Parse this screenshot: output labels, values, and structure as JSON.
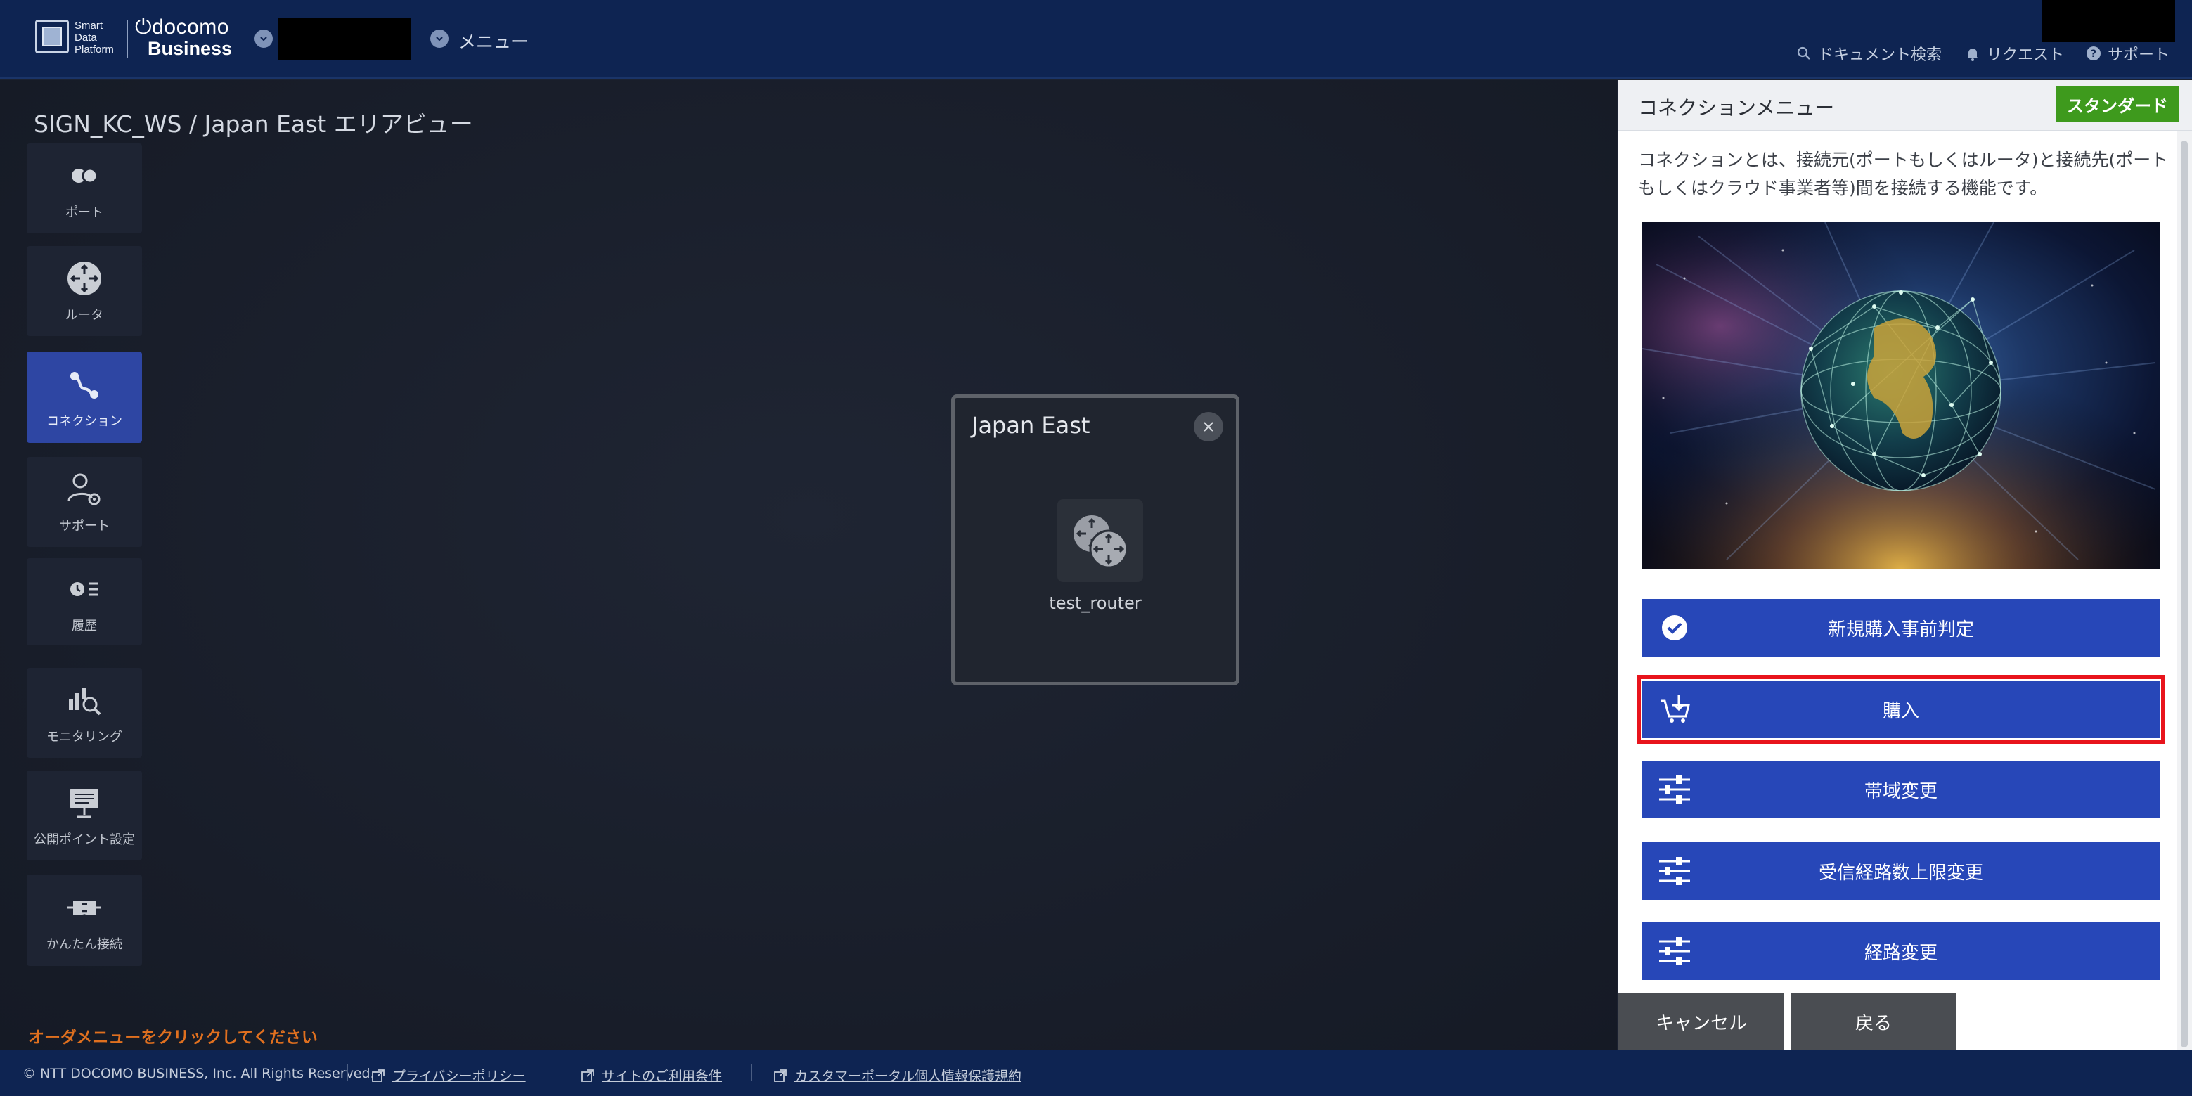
{
  "header": {
    "brand_lines": [
      "Smart",
      "Data",
      "Platform"
    ],
    "brand_docomo": "docomo",
    "brand_business": "Business",
    "menu_label": "メニュー",
    "links": {
      "doc_search": "ドキュメント検索",
      "request": "リクエスト",
      "support": "サポート"
    }
  },
  "main": {
    "page_title": "SIGN_KC_WS / Japan East エリアビュー",
    "order_hint": "オーダメニューをクリックしてください"
  },
  "sidebar": {
    "items": [
      {
        "label": "ポート",
        "icon": "port-icon",
        "active": false
      },
      {
        "label": "ルータ",
        "icon": "router-icon",
        "active": false
      },
      {
        "label": "コネクション",
        "icon": "connection-icon",
        "active": true
      },
      {
        "label": "サポート",
        "icon": "support-user-gear-icon",
        "active": false
      },
      {
        "label": "履歴",
        "icon": "history-icon",
        "active": false
      },
      {
        "label": "モニタリング",
        "icon": "monitoring-icon",
        "active": false
      },
      {
        "label": "公開ポイント設定",
        "icon": "public-point-icon",
        "active": false
      },
      {
        "label": "かんたん接続",
        "icon": "easy-connect-icon",
        "active": false
      }
    ]
  },
  "area_popup": {
    "title": "Japan East",
    "router_name": "test_router"
  },
  "panel": {
    "title": "コネクションメニュー",
    "badge": "スタンダード",
    "description": "コネクションとは、接続元(ポートもしくはルータ)と接続先(ポートもしくはクラウド事業者等)間を接続する機能です。",
    "actions": [
      {
        "label": "新規購入事前判定",
        "icon": "check-circle-icon",
        "highlighted": false
      },
      {
        "label": "購入",
        "icon": "cart-icon",
        "highlighted": true
      },
      {
        "label": "帯域変更",
        "icon": "sliders-icon",
        "highlighted": false
      },
      {
        "label": "受信経路数上限変更",
        "icon": "sliders-icon",
        "highlighted": false
      },
      {
        "label": "経路変更",
        "icon": "sliders-icon",
        "highlighted": false
      }
    ],
    "cancel_label": "キャンセル",
    "back_label": "戻る"
  },
  "footer": {
    "copyright": "© NTT DOCOMO BUSINESS, Inc. All Rights Reserved.",
    "links": {
      "privacy": "プライバシーポリシー",
      "terms": "サイトのご利用条件",
      "customer_privacy": "カスタマーポータル個人情報保護規約"
    }
  },
  "colors": {
    "header_bg": "#0e2452",
    "accent_blue": "#2747b8",
    "badge_green": "#3e9a1d",
    "highlight_red": "#e8141c",
    "hint_orange": "#e0701f"
  }
}
